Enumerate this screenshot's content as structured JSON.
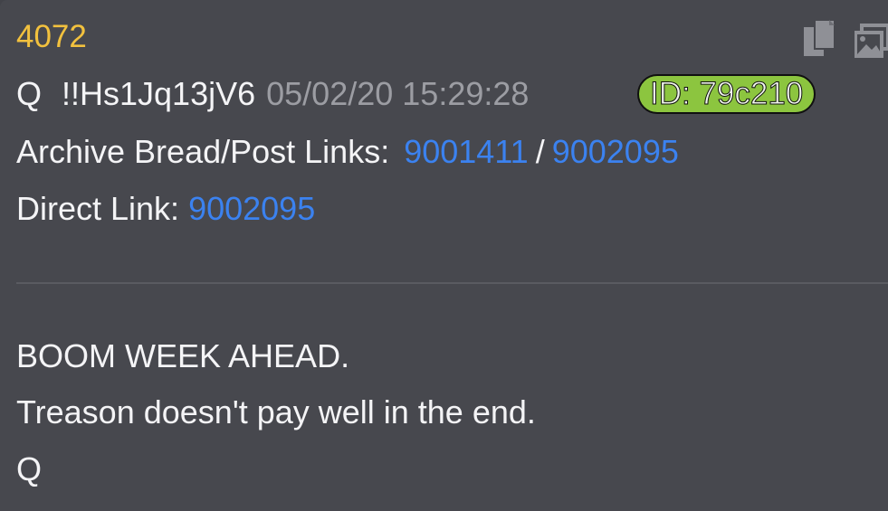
{
  "post": {
    "number": "4072",
    "author": "Q",
    "tripcode": "!!Hs1Jq13jV6",
    "timestamp": "05/02/20 15:29:28",
    "id_badge": "ID: 79c210"
  },
  "archive": {
    "label": "Archive Bread/Post Links:",
    "bread_link": "9001411",
    "separator": "/",
    "post_link": "9002095"
  },
  "direct": {
    "label": "Direct Link:",
    "link": "9002095"
  },
  "body": {
    "lines": [
      "BOOM WEEK AHEAD.",
      "Treason doesn't pay well in the end.",
      "Q"
    ]
  },
  "icons": {
    "copy": "copy-icon",
    "image": "image-icon"
  },
  "colors": {
    "post_number": "#f2c13e",
    "link": "#3b82f0",
    "id_badge_bg": "#8cc53f",
    "timestamp": "#9c9da3",
    "background": "#47484e"
  }
}
